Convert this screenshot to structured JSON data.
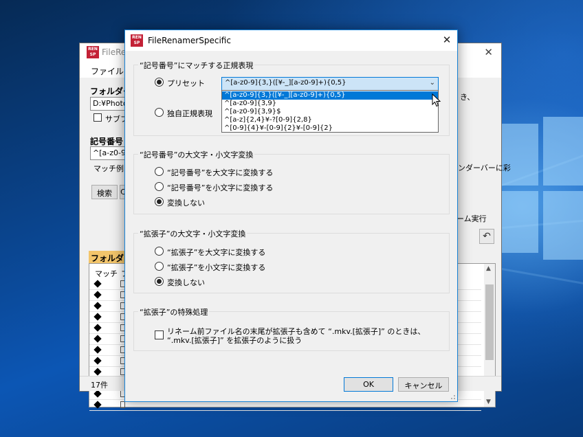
{
  "background_window": {
    "title": "FileRen",
    "menu_file": "ファイル(F)",
    "folder_label": "フォルダー",
    "folder_value": "D:¥Photos",
    "subfolder_label": "サブフ",
    "code_label": "記号番号",
    "regex_value": "^[a-z0-9]",
    "match_example_label": "マッチ例:",
    "right_text_1": "き、",
    "right_text_2": "ンダーバーに彩",
    "search_button": "検索",
    "search_button_2": "C",
    "rename_execute": "ーム実行",
    "folder_list_header": "フォルダ",
    "list_column_match": "マッチ",
    "list_column_2": "フ",
    "row_count": 12,
    "status_count": "17件",
    "undo_icon": "undo-icon"
  },
  "dialog": {
    "title": "FileRenamerSpecific",
    "logo_text": "REN SP",
    "close_glyph": "✕",
    "group_regex": {
      "title": "“記号番号”にマッチする正規表現",
      "preset_label": "プリセット",
      "custom_label": "独自正規表現",
      "preset_selected": "^[a-z0-9]{3,}([¥-_][a-z0-9]+){0,5}",
      "dropdown_options": [
        "^[a-z0-9]{3,}([¥-_][a-z0-9]+){0,5}",
        "^[a-z0-9]{3,9}",
        "^[a-z0-9]{3,9}$",
        "^[a-z]{2,4}¥-?[0-9]{2,8}",
        "^[0-9]{4}¥-[0-9]{2}¥-[0-9]{2}"
      ],
      "selected_index": 0
    },
    "group_code_case": {
      "title": "“記号番号”の大文字・小文字変換",
      "options": [
        "“記号番号”を大文字に変換する",
        "“記号番号”を小文字に変換する",
        "変換しない"
      ],
      "selected_index": 2
    },
    "group_ext_case": {
      "title": "“拡張子”の大文字・小文字変換",
      "options": [
        "“拡張子”を大文字に変換する",
        "“拡張子”を小文字に変換する",
        "変換しない"
      ],
      "selected_index": 2
    },
    "group_ext_special": {
      "title": "“拡張子”の特殊処理",
      "checkbox_line1": "リネーム前ファイル名の末尾が拡張子も含めて “.mkv.[拡張子]” のときは、",
      "checkbox_line2": "“.mkv.[拡張子]” を拡張子のように扱う",
      "checked": false
    },
    "ok_label": "OK",
    "cancel_label": "キャンセル"
  },
  "colors": {
    "accent": "#0078d7",
    "app_logo": "#c32136",
    "folder_header": "#f3c56b"
  }
}
